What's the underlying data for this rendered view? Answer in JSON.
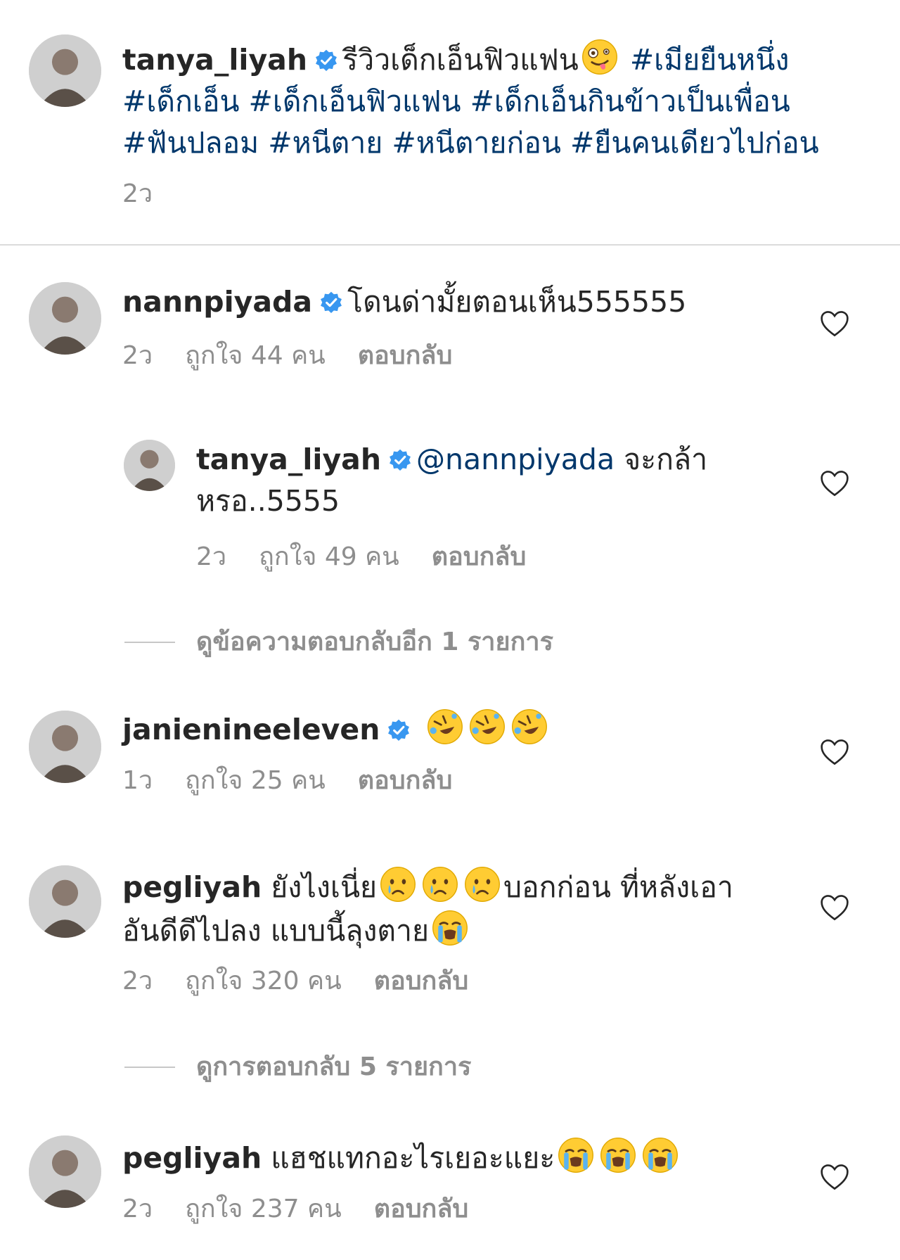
{
  "caption": {
    "username": "tanya_liyah",
    "text": "รีวิวเด็กเอ็นฟิวแฟน",
    "emoji": "zany-face",
    "hashtags_line1": "#เมียยืนหนึ่ง",
    "hashtags_line2": "#เด็กเอ็น #เด็กเอ็นฟิวแฟน #เด็กเอ็นกินข้าวเป็นเพื่อน",
    "hashtags_line3": "#ฟันปลอม #หนีตาย #หนีตายก่อน #ยืนคนเดียวไปก่อน",
    "time": "2ว"
  },
  "comments": [
    {
      "username": "nannpiyada",
      "text": "โดนด่ามั้ยตอนเห็น555555",
      "time": "2ว",
      "likes": "ถูกใจ 44 คน",
      "reply_label": "ตอบกลับ"
    },
    {
      "username": "tanya_liyah",
      "mention": "@nannpiyada",
      "text_line1": " จะกล้า",
      "text_line2": "หรอ..5555",
      "time": "2ว",
      "likes": "ถูกใจ 49 คน",
      "reply_label": "ตอบกลับ"
    },
    {
      "username": "janienineeleven",
      "emoji": "rolling-on-floor-laughing x3",
      "time": "1ว",
      "likes": "ถูกใจ 25 คน",
      "reply_label": "ตอบกลับ"
    },
    {
      "username": "pegliyah",
      "text_line1_a": "ยังไงเนี่ย",
      "text_line1_b": "บอกก่อน ที่หลังเอา",
      "text_line2": "อันดีดีไปลง แบบนี้ลุงตาย",
      "emoji": "crying-face x3, loudly-crying-face",
      "time": "2ว",
      "likes": "ถูกใจ 320 คน",
      "reply_label": "ตอบกลับ"
    },
    {
      "username": "pegliyah",
      "text": "แฮชแทกอะไรเยอะแยะ",
      "emoji": "loudly-crying-face x3",
      "time": "2ว",
      "likes": "ถูกใจ 237 คน",
      "reply_label": "ตอบกลับ"
    }
  ],
  "view_replies_1": "ดูข้อความตอบกลับอีก 1 รายการ",
  "view_replies_2": "ดูการตอบกลับ 5 รายการ",
  "colors": {
    "text": "#262626",
    "muted": "#8e8e8e",
    "link": "#00376b",
    "verified": "#3897f0",
    "emoji": "#ffcc33"
  }
}
